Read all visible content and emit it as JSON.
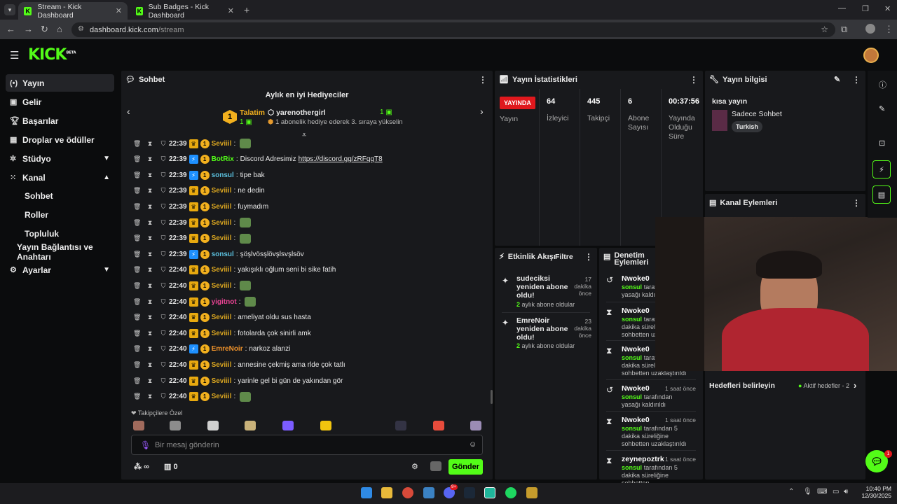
{
  "browser": {
    "tabs": [
      {
        "label": "Stream - Kick Dashboard",
        "active": true
      },
      {
        "label": "Sub Badges - Kick Dashboard",
        "active": false
      }
    ],
    "url_host": "dashboard.kick.com",
    "url_path": "/stream"
  },
  "brand": {
    "logo": "KICK",
    "beta": "BETA",
    "accent": "#53fc18"
  },
  "sidebar": {
    "items": [
      {
        "label": "Yayın",
        "icon": "broadcast-icon"
      },
      {
        "label": "Gelir",
        "icon": "revenue-icon"
      },
      {
        "label": "Başarılar",
        "icon": "trophy-icon"
      },
      {
        "label": "Droplar ve ödüller",
        "icon": "gift-icon"
      },
      {
        "label": "Stüdyo",
        "icon": "studio-icon"
      },
      {
        "label": "Kanal",
        "icon": "channel-icon"
      },
      {
        "label": "Sohbet"
      },
      {
        "label": "Roller"
      },
      {
        "label": "Topluluk"
      },
      {
        "label": "Yayın Bağlantısı ve Anahtarı"
      },
      {
        "label": "Ayarlar",
        "icon": "gear-icon"
      }
    ]
  },
  "chat": {
    "title": "Sohbet",
    "gifters_title": "Aylık en iyi Hediyeciler",
    "gifter_1_name": "Talatim",
    "gifter_1_count": "1",
    "gifter_me_name": "yarenothergirl",
    "gifter_me_count": "1",
    "gifter_hint": "1 abonelik hediye ederek 3. sıraya yükselin",
    "messages": [
      {
        "time": "22:39",
        "user": "Seviiil",
        "text": "",
        "emote": true,
        "color": "#d9a520",
        "badge": "crown"
      },
      {
        "time": "22:39",
        "user": "BotRix",
        "text": "Discord Adresimiz ",
        "link": "https://discord.gg/zRFqqT8",
        "color": "#53fc18",
        "badge": "bot"
      },
      {
        "time": "22:39",
        "user": "sonsul",
        "text": "tipe bak",
        "color": "#5bc0de",
        "badge": "bot"
      },
      {
        "time": "22:39",
        "user": "Seviiil",
        "text": "ne dedin",
        "color": "#d9a520",
        "badge": "crown"
      },
      {
        "time": "22:39",
        "user": "Seviiil",
        "text": "fuymadım",
        "color": "#d9a520",
        "badge": "crown"
      },
      {
        "time": "22:39",
        "user": "Seviiil",
        "text": "",
        "emote": true,
        "color": "#d9a520",
        "badge": "crown"
      },
      {
        "time": "22:39",
        "user": "Seviiil",
        "text": "",
        "emote": true,
        "color": "#d9a520",
        "badge": "crown"
      },
      {
        "time": "22:39",
        "user": "sonsul",
        "text": "şöşlvösşlövşlsvşlsöv",
        "color": "#5bc0de",
        "badge": "bot"
      },
      {
        "time": "22:40",
        "user": "Seviiil",
        "text": "yakışıklı oğlum seni bi sike fatih",
        "color": "#d9a520",
        "badge": "crown"
      },
      {
        "time": "22:40",
        "user": "Seviiil",
        "text": "",
        "emote": true,
        "color": "#d9a520",
        "badge": "crown"
      },
      {
        "time": "22:40",
        "user": "yigitnot",
        "text": "",
        "emote": true,
        "color": "#e84393",
        "badge": "crown"
      },
      {
        "time": "22:40",
        "user": "Seviiil",
        "text": "ameliyat oldu sus hasta",
        "color": "#d9a520",
        "badge": "crown"
      },
      {
        "time": "22:40",
        "user": "Seviiil",
        "text": "fotolarda çok sinirli amk",
        "color": "#d9a520",
        "badge": "crown"
      },
      {
        "time": "22:40",
        "user": "EmreNoir",
        "text": "narkoz alanzi",
        "color": "#f0932b",
        "badge": "bot"
      },
      {
        "time": "22:40",
        "user": "Seviiil",
        "text": "annesine çekmiş ama rlde çok tatlı",
        "color": "#d9a520",
        "badge": "crown"
      },
      {
        "time": "22:40",
        "user": "Seviiil",
        "text": "yarinle gel bi gün de yakından gör",
        "color": "#d9a520",
        "badge": "crown"
      },
      {
        "time": "22:40",
        "user": "Seviiil",
        "text": "",
        "emote": true,
        "color": "#d9a520",
        "badge": "crown"
      }
    ],
    "followers_label": "Takipçilere Özel",
    "input_placeholder": "Bir mesaj gönderin",
    "points": "∞",
    "store_count": "0",
    "send_label": "Gönder"
  },
  "stats": {
    "title": "Yayın İstatistikleri",
    "live_label": "YAYINDA",
    "live_sub": "Yayın",
    "viewers_value": "64",
    "viewers_label": "İzleyici",
    "followers_value": "445",
    "followers_label": "Takipçi",
    "subs_value": "6",
    "subs_label": "Abone Sayısı",
    "uptime_value": "00:37:56",
    "uptime_label": "Yayında Olduğu Süre"
  },
  "stream_info": {
    "title": "Yayın bilgisi",
    "stream_title": "kısa yayın",
    "category": "Sadece Sohbet",
    "tag": "Turkish"
  },
  "channel_actions": {
    "title": "Kanal Eylemleri"
  },
  "activity": {
    "title": "Etkinlik Akışı",
    "filter": "Filtre",
    "items": [
      {
        "title": "sudeciksi yeniden abone oldu!",
        "count": "2",
        "sub": "aylık abone oldular",
        "ago_num": "17",
        "ago": "dakika önce"
      },
      {
        "title": "EmreNoir yeniden abone oldu!",
        "count": "2",
        "sub": "aylık abone oldular",
        "ago_num": "23",
        "ago": "dakika önce"
      }
    ]
  },
  "moderation": {
    "title": "Denetim Eylemleri",
    "items": [
      {
        "user": "Nwoke0",
        "by": "sonsul",
        "text": "tarafından yasağı kaldırıldı",
        "time": "",
        "icon": "undo-icon"
      },
      {
        "user": "Nwoke0",
        "by": "sonsul",
        "text": "tarafından 5 dakika süreliğine sohbetten uzaklaştırıldı",
        "time": "",
        "icon": "hourglass-icon"
      },
      {
        "user": "Nwoke0",
        "by": "sonsul",
        "text": "tarafından 5 dakika süreliğine sohbetten uzaklaştırıldı",
        "time": "",
        "icon": "hourglass-icon"
      },
      {
        "user": "Nwoke0",
        "by": "sonsul",
        "text": "tarafından yasağı kaldırıldı",
        "time": "1 saat önce",
        "icon": "undo-icon"
      },
      {
        "user": "Nwoke0",
        "by": "sonsul",
        "text": "tarafından 5 dakika süreliğine sohbetten uzaklaştırıldı",
        "time": "1 saat önce",
        "icon": "hourglass-icon"
      },
      {
        "user": "zeynepoztrk",
        "by": "sonsul",
        "text": "tarafından 5 dakika süreliğine sohbetten",
        "time": "1 saat önce",
        "icon": "hourglass-icon"
      }
    ]
  },
  "goals": {
    "title": "Hedefleri belirleyin",
    "active_label": "Aktif hedefler - 2"
  },
  "help_badge": "1",
  "taskbar": {
    "time": "10:40 PM",
    "date": "12/30/2025",
    "notif_badge": "9+"
  }
}
